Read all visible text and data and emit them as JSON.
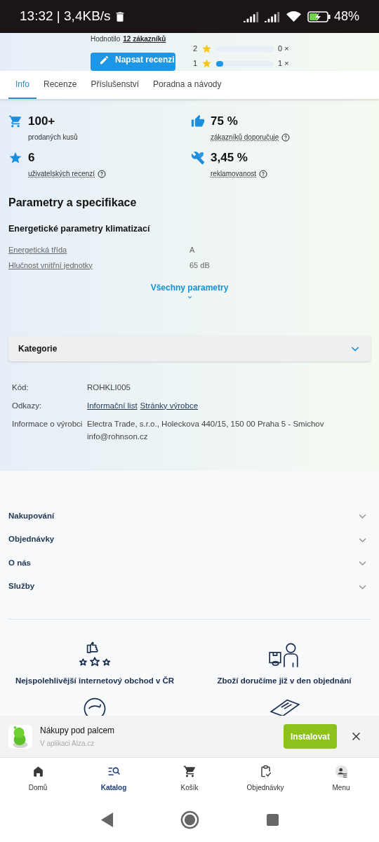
{
  "status_bar": {
    "time": "13:32 | 3,4KB/s",
    "battery": "48%"
  },
  "review_summary": {
    "rated_by_label": "Hodnotilo",
    "rated_by_link": "12 zákazníků",
    "write_button": "Napsat recenzi",
    "rating_rows": [
      {
        "label": "2",
        "count": "0 ×"
      },
      {
        "label": "1",
        "level": 0.12,
        "count": "1 ×"
      }
    ]
  },
  "tabs": [
    {
      "label": "Info",
      "selected": true
    },
    {
      "label": "Recenze",
      "selected": false
    },
    {
      "label": "Příslušenství",
      "selected": false
    },
    {
      "label": "Poradna a návody",
      "selected": false
    }
  ],
  "stats": [
    {
      "kind": "cart",
      "value": "100+",
      "label": "prodaných kusů",
      "help": false
    },
    {
      "kind": "thumb",
      "value": "75 %",
      "label": "zákazníků doporučuje",
      "help": true
    },
    {
      "kind": "star",
      "value": "6",
      "label": "uživatelských recenzí",
      "help": true
    },
    {
      "kind": "tools",
      "value": "3,45 %",
      "label": "reklamovanost",
      "help": true
    }
  ],
  "parameters": {
    "title": "Parametry a specifikace",
    "group_title": "Energetické parametry klimatizací",
    "rows": [
      {
        "name": "Energetická třída",
        "value": "A"
      },
      {
        "name": "Hlučnost vnitřní jednotky",
        "value": "65 dB"
      }
    ],
    "more_link": "Všechny parametry"
  },
  "category": {
    "label": "Kategorie",
    "expanded": false
  },
  "product_info": [
    {
      "label": "Kód:",
      "value": "ROHKLI005"
    },
    {
      "label": "Odkazy:",
      "links": [
        "Informační list",
        "Stránky výrobce"
      ]
    },
    {
      "label": "Informace o výrobci",
      "value": "Electra Trade, s.r.o., Holeckova 440/15, 150 00 Praha 5 - Smichov info@rohnson.cz"
    }
  ],
  "footer_sections": [
    {
      "label": "Nakupování",
      "expanded": false
    },
    {
      "label": "Objednávky",
      "expanded": false
    },
    {
      "label": "O nás",
      "expanded": false
    },
    {
      "label": "Služby",
      "expanded": false
    }
  ],
  "benefits": [
    {
      "kind": "rating",
      "text": "Nejspolehlivější internetový obchod v ČR"
    },
    {
      "kind": "delivery",
      "text": "Zboží doručíme již v den objednání"
    },
    {
      "kind": "return"
    },
    {
      "kind": "card"
    }
  ],
  "app_banner": {
    "title": "Nákupy pod palcem",
    "subtitle": "V aplikaci Alza.cz",
    "install_button": "Instalovat"
  },
  "bottom_nav": [
    {
      "kind": "home",
      "label": "Domů",
      "selected": false
    },
    {
      "kind": "catalog",
      "label": "Katalog",
      "selected": true
    },
    {
      "kind": "cart",
      "label": "Košík",
      "selected": false
    },
    {
      "kind": "orders",
      "label": "Objednávky",
      "selected": false
    },
    {
      "kind": "menu",
      "label": "Menu",
      "selected": false
    }
  ]
}
